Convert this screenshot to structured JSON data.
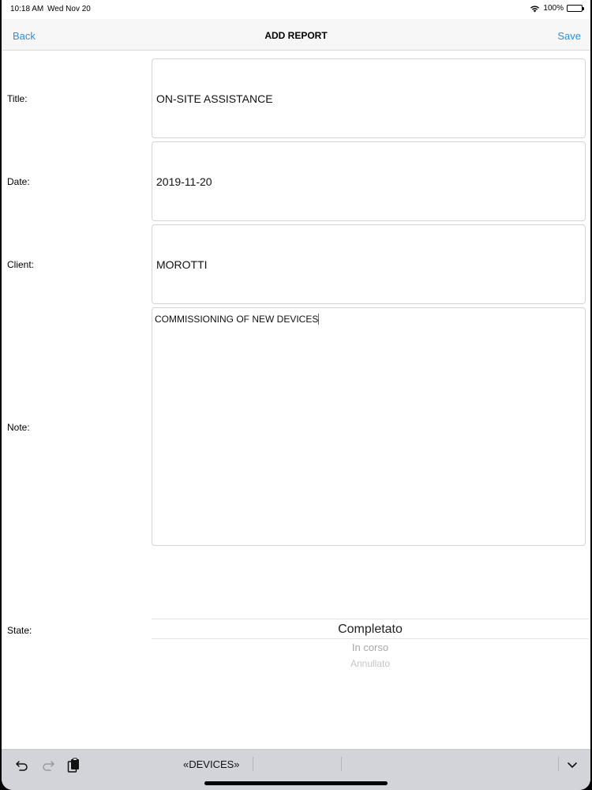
{
  "status_bar": {
    "time": "10:18 AM",
    "date": "Wed Nov 20",
    "battery": "100%"
  },
  "nav": {
    "back_label": "Back",
    "title": "ADD REPORT",
    "save_label": "Save"
  },
  "form": {
    "title_label": "Title:",
    "title_value": "ON-SITE ASSISTANCE",
    "date_label": "Date:",
    "date_value": "2019-11-20",
    "client_label": "Client:",
    "client_value": "MOROTTI",
    "note_label": "Note:",
    "note_value": "COMMISSIONING OF NEW DEVICES",
    "state_label": "State:",
    "state_options": [
      "Completato",
      "In corso",
      "Annullato"
    ],
    "state_selected": "Completato"
  },
  "keyboard_bar": {
    "suggestions": [
      "«DEVICES»",
      "",
      ""
    ],
    "icons": [
      "undo-icon",
      "redo-icon",
      "paste-icon",
      "keyboard-dismiss-icon"
    ]
  }
}
